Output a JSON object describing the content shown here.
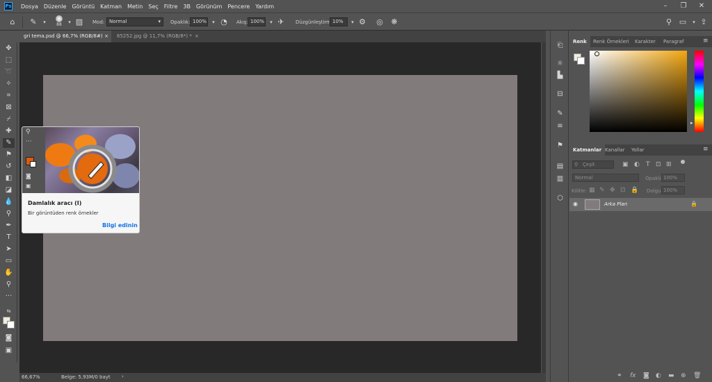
{
  "app": {
    "logo_text": "Ps"
  },
  "menu": [
    "Dosya",
    "Düzenle",
    "Görüntü",
    "Katman",
    "Metin",
    "Seç",
    "Filtre",
    "3B",
    "Görünüm",
    "Pencere",
    "Yardım"
  ],
  "options_bar": {
    "brush_size": "88",
    "mode_label": "Mod:",
    "mode_value": "Normal",
    "opacity_label": "Opaklık:",
    "opacity_value": "100%",
    "flow_label": "Akış:",
    "flow_value": "100%",
    "smoothing_label": "Düzgünleştirme:",
    "smoothing_value": "10%"
  },
  "tabs": [
    {
      "label": "gri tema.psd @ 66,7% (RGB/8#)",
      "active": true,
      "close": "×"
    },
    {
      "label": "65252.jpg @ 11,7% (RGB/8*) *",
      "active": false,
      "close": "×"
    }
  ],
  "tooltip": {
    "title": "Damlalık aracı (I)",
    "description": "Bir görüntüden renk örnekler",
    "link": "Bilgi edinin"
  },
  "status": {
    "zoom": "66,67%",
    "doc_info": "Belge: 5,93M/0 bayt",
    "arrow": "›"
  },
  "color_panel": {
    "tabs": [
      "Renk",
      "Renk Örnekleri",
      "Karakter",
      "Paragraf"
    ],
    "picker_hue": "#f2a60f"
  },
  "layers_panel": {
    "tabs": [
      "Katmanlar",
      "Kanallar",
      "Yollar"
    ],
    "search_placeholder": "Çeşit",
    "blend_mode": "Normal",
    "opacity_label": "Opaklık:",
    "opacity_value": "100%",
    "lock_label": "Kilitle:",
    "fill_label": "Dolgu:",
    "fill_value": "100%",
    "layers": [
      {
        "name": "Arka Plan"
      }
    ]
  },
  "colors": {
    "canvas": "#827b7b",
    "foreground_swatch": "#e05a10",
    "accent_link": "#1473e6"
  }
}
